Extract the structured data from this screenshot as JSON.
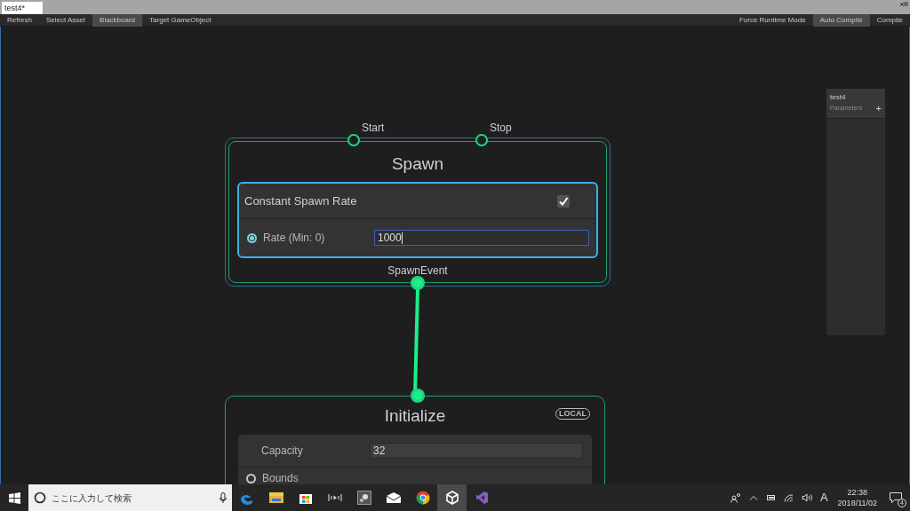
{
  "window": {
    "tab": "test4*"
  },
  "toolbar": {
    "left": [
      {
        "label": "Refresh",
        "selected": false
      },
      {
        "label": "Select Asset",
        "selected": false
      },
      {
        "label": "Blackboard",
        "selected": true
      },
      {
        "label": "Target GameObject",
        "selected": false
      }
    ],
    "right": [
      {
        "label": "Force Runtime Mode",
        "selected": false
      },
      {
        "label": "Auto Compile",
        "selected": true
      },
      {
        "label": "Compile",
        "selected": false
      }
    ]
  },
  "spawn_node": {
    "title": "Spawn",
    "inputs": [
      {
        "label": "Start",
        "connected": false
      },
      {
        "label": "Stop",
        "connected": false
      }
    ],
    "block": {
      "title": "Constant Spawn Rate",
      "checked": true,
      "field": {
        "label": "Rate (Min: 0)",
        "linked": true,
        "value": "1000"
      }
    },
    "output": {
      "label": "SpawnEvent",
      "connected": true
    }
  },
  "initialize_node": {
    "title": "Initialize",
    "badge": "LOCAL",
    "input_connected": true,
    "fields": [
      {
        "label": "Capacity",
        "value": "32"
      }
    ],
    "properties": [
      {
        "label": "Bounds",
        "linked": false
      }
    ]
  },
  "blackboard": {
    "title": "test4",
    "subtitle": "Parameters",
    "add": "+"
  },
  "taskbar": {
    "search_placeholder": "ここに入力して検索",
    "apps": [
      {
        "selected": false
      },
      {
        "selected": false
      },
      {
        "selected": false
      },
      {
        "selected": false
      },
      {
        "selected": false
      },
      {
        "selected": false
      },
      {
        "selected": false
      },
      {
        "selected": true
      },
      {
        "selected": false
      }
    ],
    "ime": "A",
    "time": "22:38",
    "date": "2018/11/02",
    "notifications": "4"
  }
}
